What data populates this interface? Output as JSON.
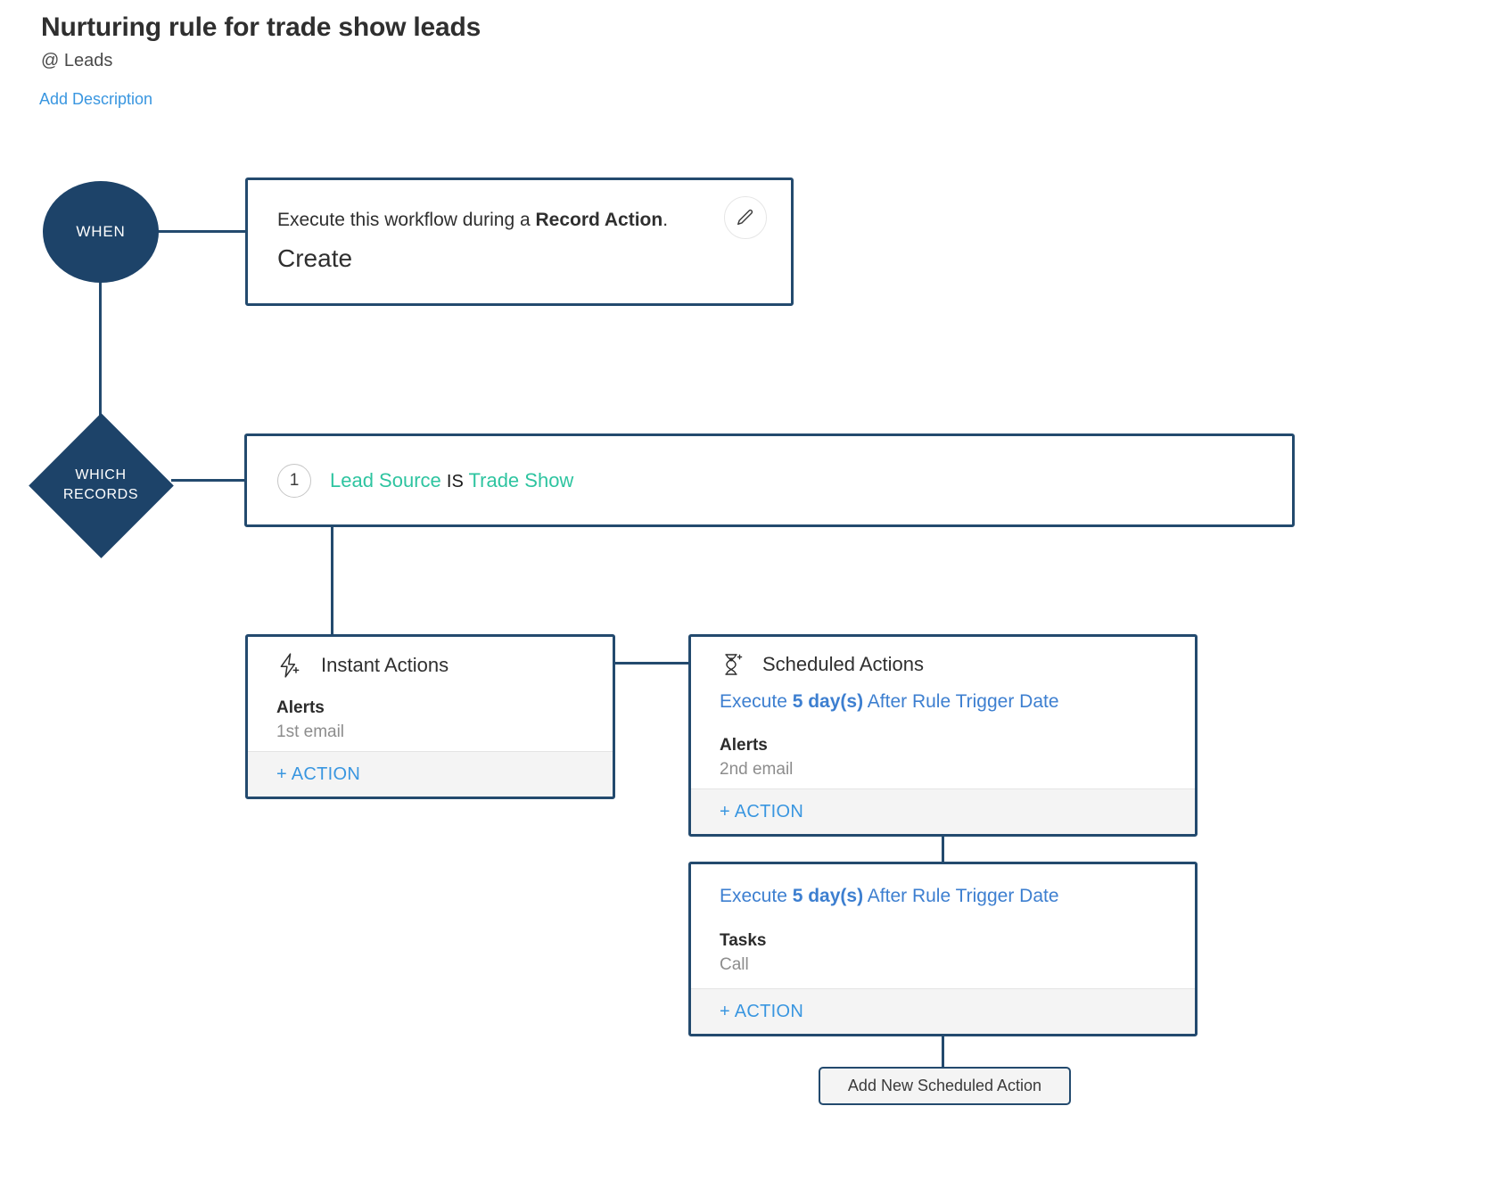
{
  "header": {
    "title": "Nurturing rule for trade show leads",
    "module": "@ Leads",
    "add_description_link": "Add Description"
  },
  "colors": {
    "navy": "#1d4369",
    "connector": "#234a6e",
    "link_blue": "#3996e0",
    "schedule_blue": "#3d7fd0",
    "teal": "#2ec4a0",
    "footer_gray": "#f4f4f4",
    "muted_text": "#8d8d8d"
  },
  "when": {
    "node_label": "WHEN",
    "card": {
      "sentence_prefix": "Execute this workflow during a ",
      "sentence_strong": "Record Action",
      "sentence_suffix": ".",
      "value": "Create",
      "edit_icon": "pencil-icon"
    }
  },
  "which_records": {
    "node_label_line1": "WHICH",
    "node_label_line2": "RECORDS",
    "conditions": [
      {
        "index": "1",
        "field": "Lead Source",
        "operator": "IS",
        "value": "Trade Show"
      }
    ]
  },
  "instant_actions": {
    "icon": "lightning-bolt-plus-icon",
    "title": "Instant Actions",
    "groups": [
      {
        "title": "Alerts",
        "item": "1st email"
      }
    ],
    "add_action_label": "+ ACTION"
  },
  "scheduled_actions": [
    {
      "icon": "hourglass-plus-icon",
      "title": "Scheduled Actions",
      "schedule_prefix": "Execute ",
      "schedule_strong": "5 day(s)",
      "schedule_suffix": " After Rule Trigger Date",
      "groups": [
        {
          "title": "Alerts",
          "item": "2nd email"
        }
      ],
      "add_action_label": "+ ACTION"
    },
    {
      "icon": null,
      "title": null,
      "schedule_prefix": "Execute ",
      "schedule_strong": "5 day(s)",
      "schedule_suffix": " After Rule Trigger Date",
      "groups": [
        {
          "title": "Tasks",
          "item": "Call"
        }
      ],
      "add_action_label": "+ ACTION"
    }
  ],
  "footer": {
    "add_new_scheduled_action_label": "Add New Scheduled Action"
  }
}
